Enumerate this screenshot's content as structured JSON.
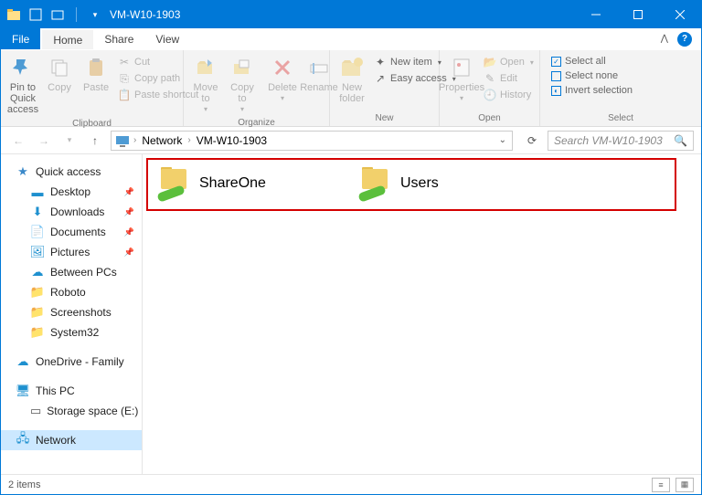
{
  "window": {
    "title": "VM-W10-1903"
  },
  "tabs": {
    "file": "File",
    "home": "Home",
    "share": "Share",
    "view": "View"
  },
  "ribbon": {
    "clipboard": {
      "label": "Clipboard",
      "pin": "Pin to Quick access",
      "copy": "Copy",
      "paste": "Paste",
      "cut": "Cut",
      "copypath": "Copy path",
      "pasteshortcut": "Paste shortcut"
    },
    "organize": {
      "label": "Organize",
      "moveto": "Move to",
      "copyto": "Copy to",
      "delete": "Delete",
      "rename": "Rename"
    },
    "new": {
      "label": "New",
      "newfolder": "New folder",
      "newitem": "New item",
      "easyaccess": "Easy access"
    },
    "open": {
      "label": "Open",
      "properties": "Properties",
      "open": "Open",
      "edit": "Edit",
      "history": "History"
    },
    "select": {
      "label": "Select",
      "all": "Select all",
      "none": "Select none",
      "invert": "Invert selection"
    }
  },
  "breadcrumb": {
    "root": "Network",
    "current": "VM-W10-1903"
  },
  "search": {
    "placeholder": "Search VM-W10-1903"
  },
  "nav": {
    "quick": "Quick access",
    "desktop": "Desktop",
    "downloads": "Downloads",
    "documents": "Documents",
    "pictures": "Pictures",
    "between": "Between PCs",
    "roboto": "Roboto",
    "screenshots": "Screenshots",
    "system32": "System32",
    "onedrive": "OneDrive - Family",
    "thispc": "This PC",
    "storage": "Storage space (E:)",
    "network": "Network"
  },
  "shares": [
    {
      "name": "ShareOne"
    },
    {
      "name": "Users"
    }
  ],
  "status": {
    "count": "2 items"
  }
}
